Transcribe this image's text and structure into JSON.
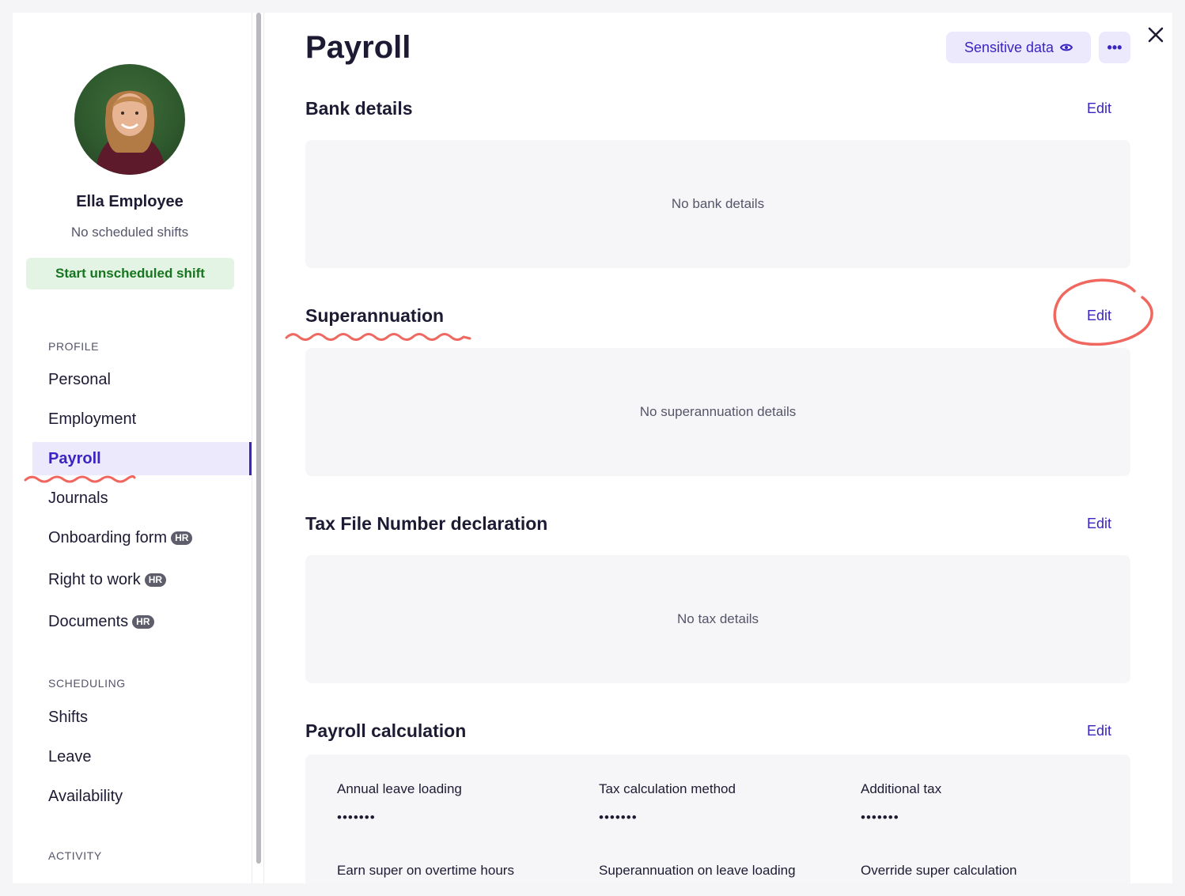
{
  "employee": {
    "name": "Ella Employee",
    "status": "No scheduled shifts",
    "start_shift_label": "Start unscheduled shift"
  },
  "sidebar": {
    "profile_title": "PROFILE",
    "scheduling_title": "SCHEDULING",
    "activity_title": "ACTIVITY",
    "profile_items": [
      {
        "label": "Personal"
      },
      {
        "label": "Employment"
      },
      {
        "label": "Payroll",
        "active": true
      },
      {
        "label": "Journals"
      },
      {
        "label": "Onboarding form",
        "badge": "HR"
      },
      {
        "label": "Right to work",
        "badge": "HR"
      },
      {
        "label": "Documents",
        "badge": "HR"
      }
    ],
    "scheduling_items": [
      {
        "label": "Shifts"
      },
      {
        "label": "Leave"
      },
      {
        "label": "Availability"
      }
    ]
  },
  "main": {
    "title": "Payroll",
    "sensitive_label": "Sensitive data",
    "more_label": "•••",
    "sections": [
      {
        "heading": "Bank details",
        "edit": "Edit",
        "empty": "No bank details"
      },
      {
        "heading": "Superannuation",
        "edit": "Edit",
        "empty": "No superannuation details"
      },
      {
        "heading": "Tax File Number declaration",
        "edit": "Edit",
        "empty": "No tax details"
      },
      {
        "heading": "Payroll calculation",
        "edit": "Edit"
      }
    ],
    "calc_fields": [
      {
        "label": "Annual leave loading",
        "value": "•••••••"
      },
      {
        "label": "Tax calculation method",
        "value": "•••••••"
      },
      {
        "label": "Additional tax",
        "value": "•••••••"
      },
      {
        "label": "Earn super on overtime hours",
        "value": ""
      },
      {
        "label": "Superannuation on leave loading",
        "value": ""
      },
      {
        "label": "Override super calculation",
        "value": ""
      }
    ]
  },
  "colors": {
    "accent": "#3a25c2",
    "accent_bg": "#ece9fd",
    "success_text": "#17751f",
    "success_bg": "#e3f4e5",
    "annotation": "#f0675f"
  },
  "icons": [
    "eye-icon",
    "more-icon",
    "close-icon",
    "avatar"
  ]
}
